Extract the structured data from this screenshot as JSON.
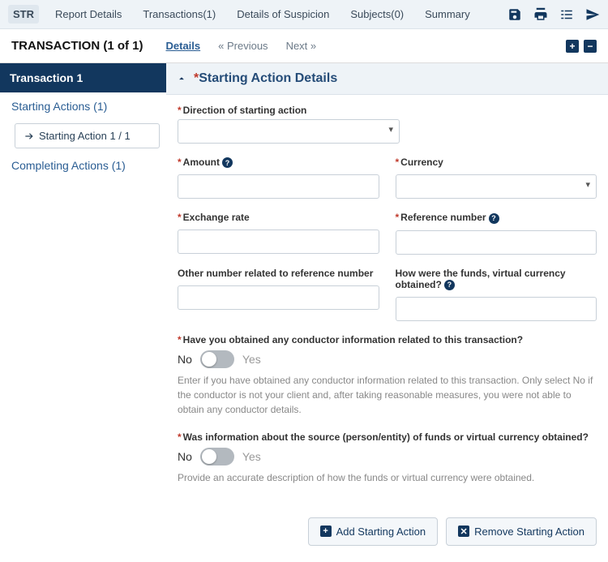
{
  "topbar": {
    "tabs": [
      "STR",
      "Report Details",
      "Transactions(1)",
      "Details of Suspicion",
      "Subjects(0)",
      "Summary"
    ],
    "activeTab": 0
  },
  "subheader": {
    "title": "TRANSACTION (1 of 1)",
    "tabDetails": "Details",
    "prev": "« Previous",
    "next": "Next »"
  },
  "sidebar": {
    "header": "Transaction 1",
    "starting": "Starting Actions (1)",
    "startingSub": "Starting Action 1 / 1",
    "completing": "Completing Actions (1)"
  },
  "section": {
    "title": "Starting Action Details"
  },
  "fields": {
    "direction": {
      "label": "Direction of starting action",
      "value": ""
    },
    "amount": {
      "label": "Amount",
      "value": ""
    },
    "currency": {
      "label": "Currency",
      "value": ""
    },
    "exchange": {
      "label": "Exchange rate",
      "value": ""
    },
    "refnum": {
      "label": "Reference number",
      "value": ""
    },
    "otherref": {
      "label": "Other number related to reference number",
      "value": ""
    },
    "obtained": {
      "label": "How were the funds, virtual currency obtained?",
      "value": ""
    }
  },
  "toggles": {
    "conductor": {
      "question": "Have you obtained any conductor information related to this transaction?",
      "no": "No",
      "yes": "Yes",
      "hint": "Enter if you have obtained any conductor information related to this transaction. Only select No if the conductor is not your client and, after taking reasonable measures, you were not able to obtain any conductor details."
    },
    "source": {
      "question": "Was information about the source (person/entity) of funds or virtual currency obtained?",
      "no": "No",
      "yes": "Yes",
      "hint": "Provide an accurate description of how the funds or virtual currency were obtained."
    }
  },
  "buttons": {
    "add": "Add Starting Action",
    "remove": "Remove Starting Action"
  }
}
